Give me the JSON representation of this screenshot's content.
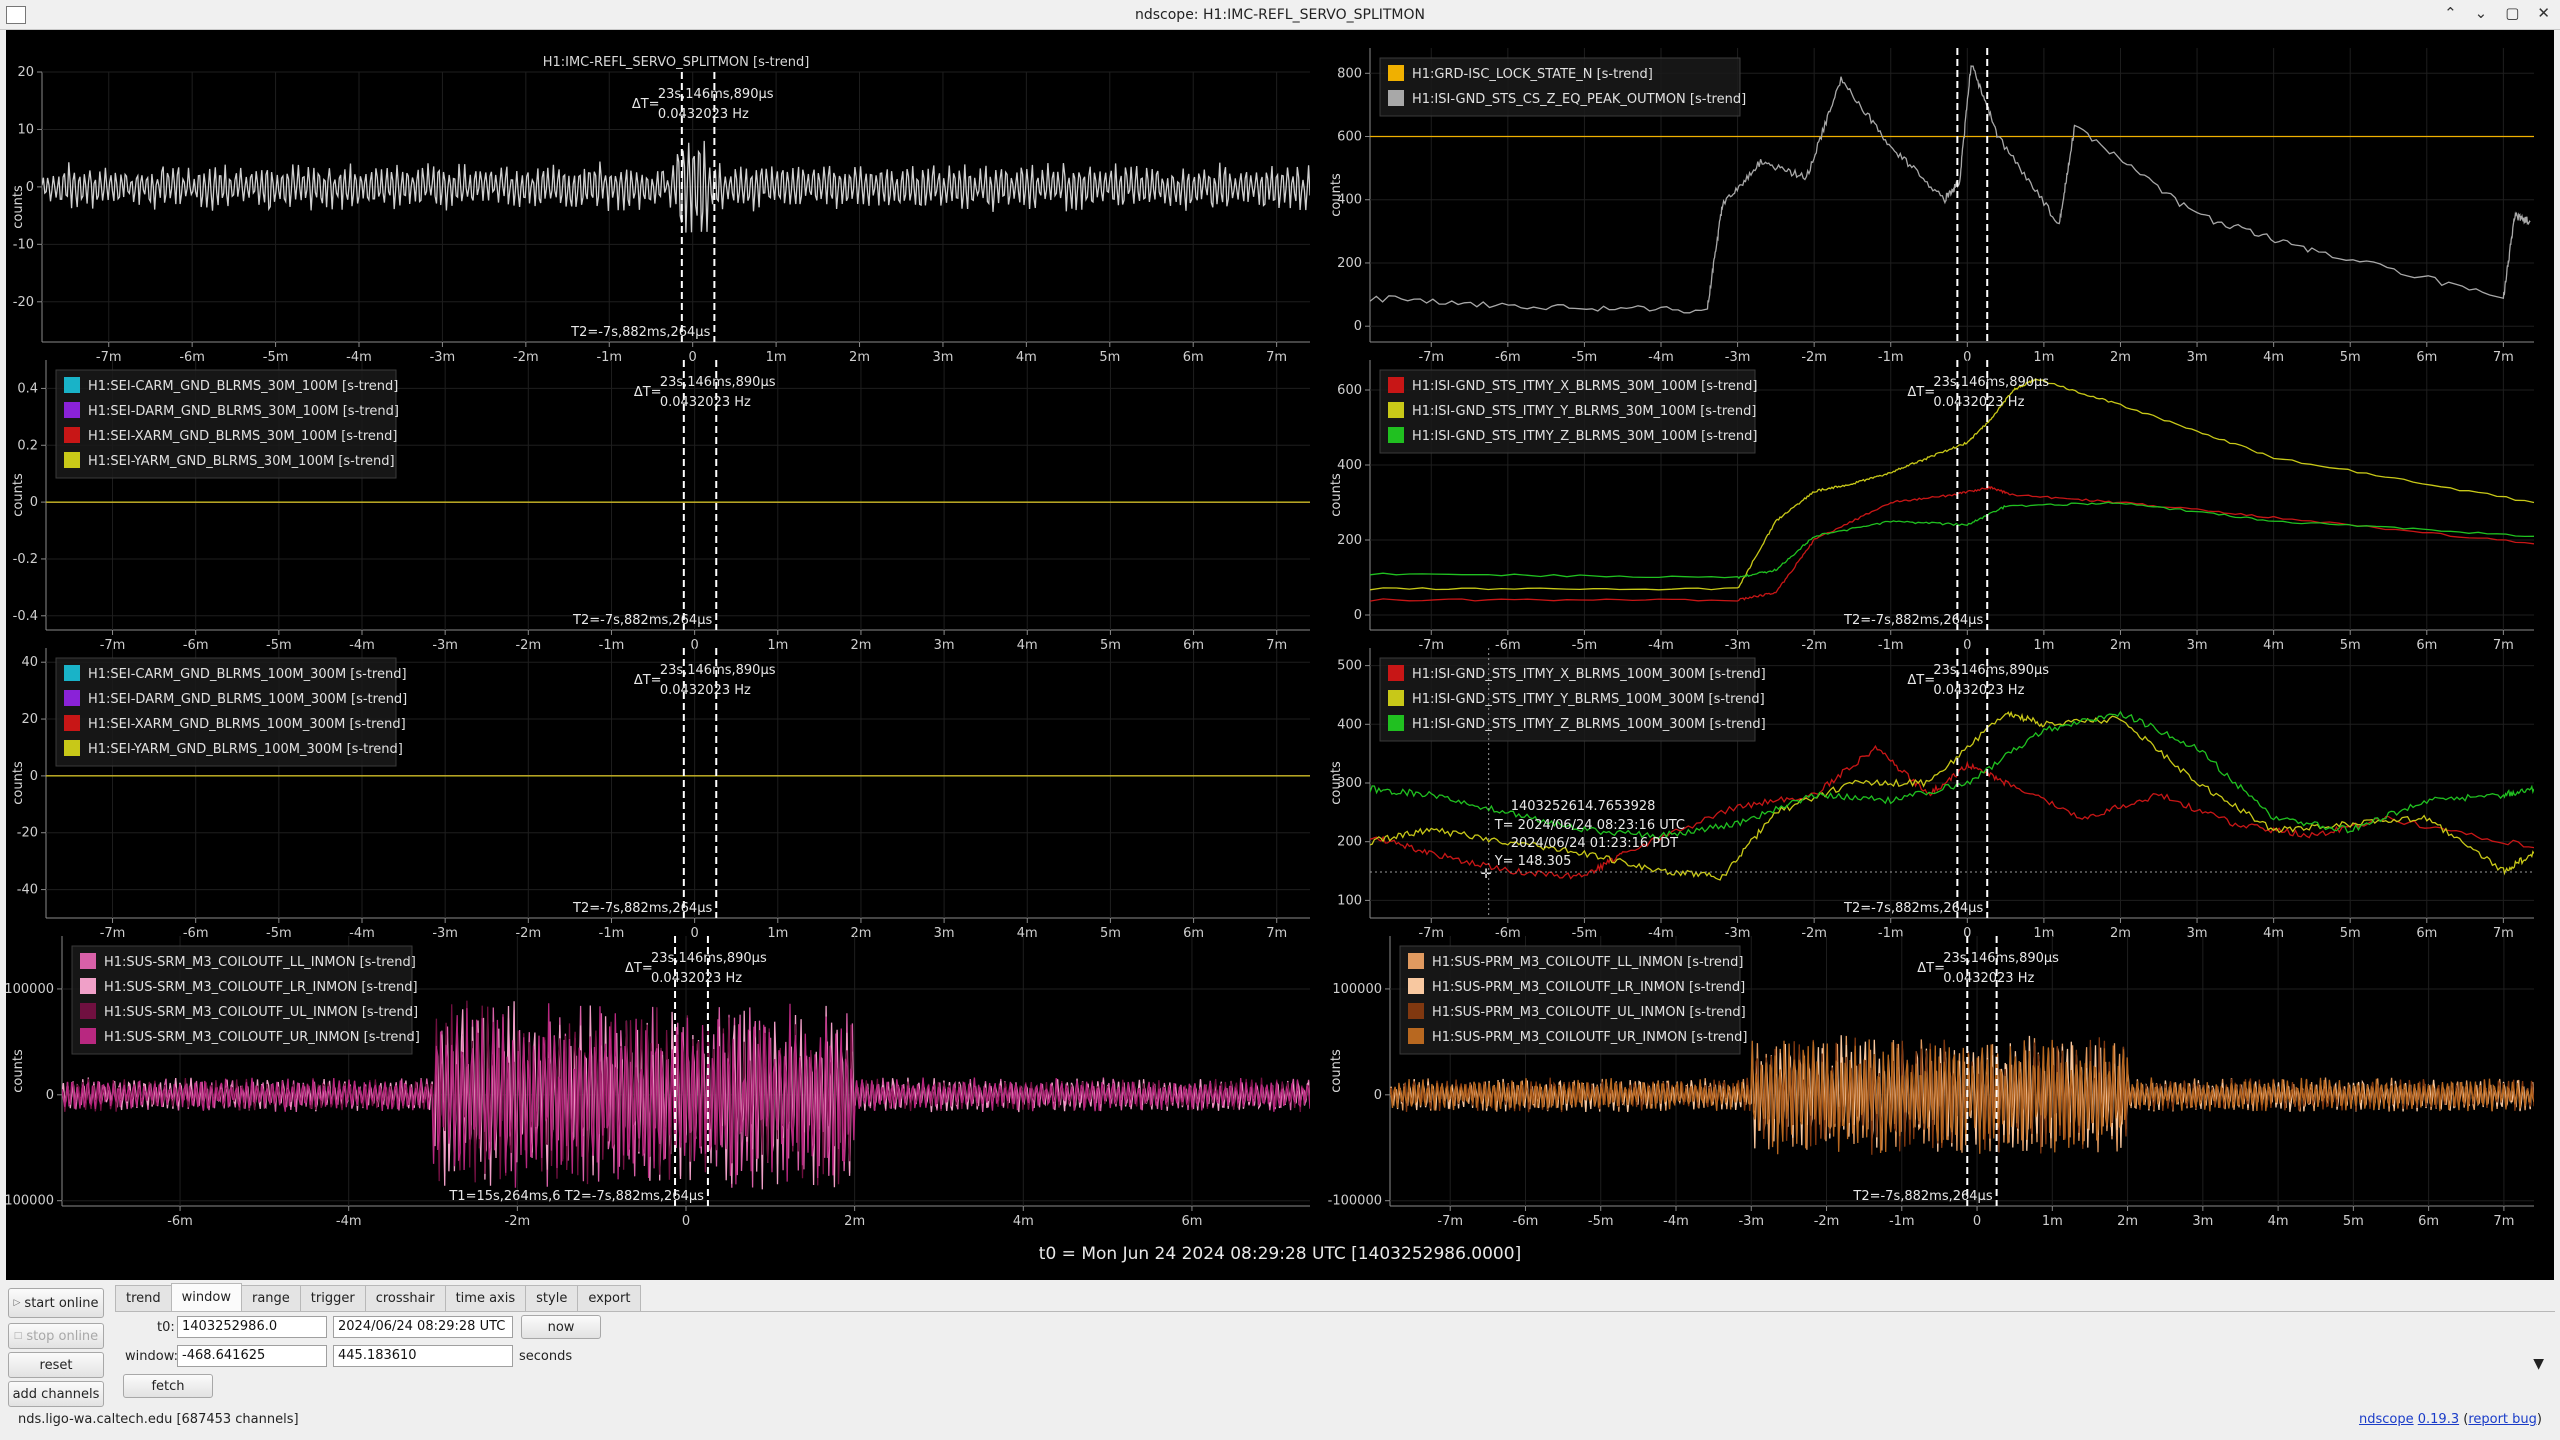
{
  "window": {
    "title": "ndscope: H1:IMC-REFL_SERVO_SPLITMON",
    "controls": [
      "⌃",
      "⌄",
      "▢",
      "✕"
    ]
  },
  "plots": [
    {
      "ylabel": "counts",
      "title": "H1:IMC-REFL_SERVO_SPLITMON [s-trend]",
      "yticks": [
        "20",
        "10",
        "0",
        "-10",
        "-20"
      ],
      "xticks": [
        "-7m",
        "-6m",
        "-5m",
        "-4m",
        "-3m",
        "-2m",
        "-1m",
        "0",
        "1m",
        "2m",
        "3m",
        "4m",
        "5m",
        "6m",
        "7m"
      ],
      "cursor_dt": "23s,146ms,890μs",
      "cursor_freq": "0.0432023 Hz",
      "cursor_dt_prefix": "ΔT=",
      "cursor_t": "T2=-7s,882ms,264μs",
      "legend": []
    },
    {
      "ylabel": "counts",
      "title": "",
      "yticks": [
        "800",
        "600",
        "400",
        "200",
        "0"
      ],
      "xticks": [
        "-7m",
        "-6m",
        "-5m",
        "-4m",
        "-3m",
        "-2m",
        "-1m",
        "0",
        "1m",
        "2m",
        "3m",
        "4m",
        "5m",
        "6m",
        "7m"
      ],
      "cursor_dt": "",
      "cursor_freq": "",
      "cursor_dt_prefix": "",
      "cursor_t": "",
      "legend": [
        {
          "name": "H1:GRD-ISC_LOCK_STATE_N [s-trend]",
          "color": "#f0b000"
        },
        {
          "name": "H1:ISI-GND_STS_CS_Z_EQ_PEAK_OUTMON [s-trend]",
          "color": "#a8a8a8"
        }
      ]
    },
    {
      "ylabel": "counts",
      "title": "",
      "yticks": [
        "0.4",
        "0.2",
        "0",
        "-0.2",
        "-0.4"
      ],
      "xticks": [
        "-7m",
        "-6m",
        "-5m",
        "-4m",
        "-3m",
        "-2m",
        "-1m",
        "0",
        "1m",
        "2m",
        "3m",
        "4m",
        "5m",
        "6m",
        "7m"
      ],
      "cursor_dt": "23s,146ms,890μs",
      "cursor_freq": "0.0432023 Hz",
      "cursor_dt_prefix": "ΔT=",
      "cursor_t": "T2=-7s,882ms,264μs",
      "legend": [
        {
          "name": "H1:SEI-CARM_GND_BLRMS_30M_100M [s-trend]",
          "color": "#19b3c8"
        },
        {
          "name": "H1:SEI-DARM_GND_BLRMS_30M_100M [s-trend]",
          "color": "#8a22d8"
        },
        {
          "name": "H1:SEI-XARM_GND_BLRMS_30M_100M [s-trend]",
          "color": "#c81616"
        },
        {
          "name": "H1:SEI-YARM_GND_BLRMS_30M_100M [s-trend]",
          "color": "#c8c818"
        }
      ]
    },
    {
      "ylabel": "counts",
      "title": "",
      "yticks": [
        "600",
        "400",
        "200",
        "0"
      ],
      "xticks": [
        "-7m",
        "-6m",
        "-5m",
        "-4m",
        "-3m",
        "-2m",
        "-1m",
        "0",
        "1m",
        "2m",
        "3m",
        "4m",
        "5m",
        "6m",
        "7m"
      ],
      "cursor_dt": "23s,146ms,890μs",
      "cursor_freq": "0.0432023 Hz",
      "cursor_dt_prefix": "ΔT=",
      "cursor_t": "T2=-7s,882ms,264μs",
      "legend": [
        {
          "name": "H1:ISI-GND_STS_ITMY_X_BLRMS_30M_100M [s-trend]",
          "color": "#c81616"
        },
        {
          "name": "H1:ISI-GND_STS_ITMY_Y_BLRMS_30M_100M [s-trend]",
          "color": "#c8c818"
        },
        {
          "name": "H1:ISI-GND_STS_ITMY_Z_BLRMS_30M_100M [s-trend]",
          "color": "#20c020"
        }
      ]
    },
    {
      "ylabel": "counts",
      "title": "",
      "yticks": [
        "40",
        "20",
        "0",
        "-20",
        "-40"
      ],
      "xticks": [
        "-7m",
        "-6m",
        "-5m",
        "-4m",
        "-3m",
        "-2m",
        "-1m",
        "0",
        "1m",
        "2m",
        "3m",
        "4m",
        "5m",
        "6m",
        "7m"
      ],
      "cursor_dt": "23s,146ms,890μs",
      "cursor_freq": "0.0432023 Hz",
      "cursor_dt_prefix": "ΔT=",
      "cursor_t": "T2=-7s,882ms,264μs",
      "legend": [
        {
          "name": "H1:SEI-CARM_GND_BLRMS_100M_300M [s-trend]",
          "color": "#19b3c8"
        },
        {
          "name": "H1:SEI-DARM_GND_BLRMS_100M_300M [s-trend]",
          "color": "#8a22d8"
        },
        {
          "name": "H1:SEI-XARM_GND_BLRMS_100M_300M [s-trend]",
          "color": "#c81616"
        },
        {
          "name": "H1:SEI-YARM_GND_BLRMS_100M_300M [s-trend]",
          "color": "#c8c818"
        }
      ]
    },
    {
      "ylabel": "counts",
      "title": "",
      "yticks": [
        "500",
        "400",
        "300",
        "200",
        "100"
      ],
      "xticks": [
        "-7m",
        "-6m",
        "-5m",
        "-4m",
        "-3m",
        "-2m",
        "-1m",
        "0",
        "1m",
        "2m",
        "3m",
        "4m",
        "5m",
        "6m",
        "7m"
      ],
      "cursor_dt": "23s,146ms,890μs",
      "cursor_freq": "0.0432023 Hz",
      "cursor_dt_prefix": "ΔT=",
      "cursor_t": "T2=-7s,882ms,264μs",
      "legend": [
        {
          "name": "H1:ISI-GND_STS_ITMY_X_BLRMS_100M_300M [s-trend]",
          "color": "#c81616"
        },
        {
          "name": "H1:ISI-GND_STS_ITMY_Y_BLRMS_100M_300M [s-trend]",
          "color": "#c8c818"
        },
        {
          "name": "H1:ISI-GND_STS_ITMY_Z_BLRMS_100M_300M [s-trend]",
          "color": "#20c020"
        }
      ],
      "crosshair": {
        "gps": "1403252614.7653928",
        "utc": "T= 2024/06/24 08:23:16 UTC",
        "pdt": "2024/06/24 01:23:16 PDT",
        "y": "Y= 148.305"
      }
    },
    {
      "ylabel": "counts",
      "title": "",
      "yticks": [
        "100000",
        "0",
        "-100000"
      ],
      "xticks": [
        "-6m",
        "-4m",
        "-2m",
        "0",
        "2m",
        "4m",
        "6m"
      ],
      "cursor_dt": "23s,146ms,890μs",
      "cursor_freq": "0.0432023 Hz",
      "cursor_dt_prefix": "ΔT=",
      "cursor_t": "T1=15s,264ms,6 T2=-7s,882ms,264μs",
      "legend": [
        {
          "name": "H1:SUS-SRM_M3_COILOUTF_LL_INMON [s-trend]",
          "color": "#d860a8"
        },
        {
          "name": "H1:SUS-SRM_M3_COILOUTF_LR_INMON [s-trend]",
          "color": "#f0a0c8"
        },
        {
          "name": "H1:SUS-SRM_M3_COILOUTF_UL_INMON [s-trend]",
          "color": "#701040"
        },
        {
          "name": "H1:SUS-SRM_M3_COILOUTF_UR_INMON [s-trend]",
          "color": "#b82880"
        }
      ]
    },
    {
      "ylabel": "counts",
      "title": "",
      "yticks": [
        "100000",
        "0",
        "-100000"
      ],
      "xticks": [
        "-7m",
        "-6m",
        "-5m",
        "-4m",
        "-3m",
        "-2m",
        "-1m",
        "0",
        "1m",
        "2m",
        "3m",
        "4m",
        "5m",
        "6m",
        "7m"
      ],
      "cursor_dt": "23s,146ms,890μs",
      "cursor_freq": "0.0432023 Hz",
      "cursor_dt_prefix": "ΔT=",
      "cursor_t": "T2=-7s,882ms,264μs",
      "legend": [
        {
          "name": "H1:SUS-PRM_M3_COILOUTF_LL_INMON [s-trend]",
          "color": "#e09a60"
        },
        {
          "name": "H1:SUS-PRM_M3_COILOUTF_LR_INMON [s-trend]",
          "color": "#f8c8a0"
        },
        {
          "name": "H1:SUS-PRM_M3_COILOUTF_UL_INMON [s-trend]",
          "color": "#803810"
        },
        {
          "name": "H1:SUS-PRM_M3_COILOUTF_UR_INMON [s-trend]",
          "color": "#b86820"
        }
      ]
    }
  ],
  "t0_label": "t0 = Mon Jun 24 2024 08:29:28 UTC [1403252986.0000]",
  "left_buttons": {
    "start": "start online",
    "stop": "stop online",
    "reset": "reset",
    "add": "add channels"
  },
  "tabs": [
    "trend",
    "window",
    "range",
    "trigger",
    "crosshair",
    "time axis",
    "style",
    "export"
  ],
  "active_tab": "window",
  "window_tab": {
    "t0_label": "t0:",
    "t0_gps": "1403252986.0",
    "t0_utc": "2024/06/24 08:29:28 UTC",
    "now": "now",
    "window_label": "window:",
    "win_start": "-468.641625",
    "win_end": "445.183610",
    "seconds": "seconds",
    "fetch": "fetch"
  },
  "status": "nds.ligo-wa.caltech.edu  [687453 channels]",
  "version": {
    "name": "ndscope",
    "num": "0.19.3",
    "bug": "report bug"
  },
  "chart_data": [
    {
      "type": "line",
      "x_unit": "minutes relative to t0",
      "xlim": [
        -7.8,
        7.4
      ],
      "ylim": [
        -27,
        20
      ],
      "series": [
        {
          "name": "H1:IMC-REFL_SERVO_SPLITMON [s-trend]",
          "description": "noise fluctuating around 0, amplitude ~±3, spike to ~8 near 0"
        }
      ]
    },
    {
      "type": "line",
      "x_unit": "minutes relative to t0",
      "xlim": [
        -7.8,
        7.4
      ],
      "ylim": [
        -50,
        880
      ],
      "series": [
        {
          "name": "H1:GRD-ISC_LOCK_STATE_N [s-trend]",
          "x": [
            -7.8,
            7.4
          ],
          "y": [
            600,
            600
          ]
        },
        {
          "name": "H1:ISI-GND_STS_CS_Z_EQ_PEAK_OUTMON [s-trend]",
          "x": [
            -7.8,
            -5.5,
            -3.4,
            -3.2,
            -2.7,
            -2.1,
            -1.65,
            -1.0,
            -0.3,
            -0.1,
            0.05,
            0.4,
            1.2,
            1.4,
            3.0,
            4.5,
            7.0,
            7.15,
            7.35
          ],
          "y": [
            90,
            60,
            50,
            380,
            520,
            470,
            780,
            570,
            400,
            460,
            830,
            600,
            320,
            630,
            350,
            240,
            90,
            350,
            330
          ]
        }
      ]
    },
    {
      "type": "line",
      "x_unit": "minutes relative to t0",
      "xlim": [
        -7.8,
        7.4
      ],
      "ylim": [
        -0.45,
        0.5
      ],
      "series": [
        {
          "name": "H1:SEI-CARM_GND_BLRMS_30M_100M [s-trend]",
          "x": [
            -7.8,
            7.4
          ],
          "y": [
            0,
            0
          ]
        },
        {
          "name": "H1:SEI-DARM_GND_BLRMS_30M_100M [s-trend]",
          "x": [
            -7.8,
            7.4
          ],
          "y": [
            0,
            0
          ]
        },
        {
          "name": "H1:SEI-XARM_GND_BLRMS_30M_100M [s-trend]",
          "x": [
            -7.8,
            7.4
          ],
          "y": [
            0,
            0
          ]
        },
        {
          "name": "H1:SEI-YARM_GND_BLRMS_30M_100M [s-trend]",
          "x": [
            -7.8,
            7.4
          ],
          "y": [
            0,
            0
          ]
        }
      ]
    },
    {
      "type": "line",
      "x_unit": "minutes relative to t0",
      "xlim": [
        -7.8,
        7.4
      ],
      "ylim": [
        -40,
        680
      ],
      "series": [
        {
          "name": "H1:ISI-GND_STS_ITMY_X_BLRMS_30M_100M [s-trend]",
          "x": [
            -7.8,
            -3.0,
            -2.5,
            -2.0,
            -1.0,
            -0.2,
            0.3,
            0.6,
            2.0,
            4.0,
            7.4
          ],
          "y": [
            40,
            40,
            60,
            200,
            300,
            320,
            340,
            320,
            300,
            260,
            190
          ]
        },
        {
          "name": "H1:ISI-GND_STS_ITMY_Y_BLRMS_30M_100M [s-trend]",
          "x": [
            -7.8,
            -3.0,
            -2.5,
            -2.0,
            -1.5,
            -1.0,
            -0.5,
            0,
            0.3,
            0.6,
            0.9,
            2.0,
            4.0,
            7.4
          ],
          "y": [
            70,
            70,
            250,
            330,
            350,
            380,
            420,
            460,
            520,
            600,
            630,
            560,
            420,
            300
          ]
        },
        {
          "name": "H1:ISI-GND_STS_ITMY_Z_BLRMS_30M_100M [s-trend]",
          "x": [
            -7.8,
            -3.0,
            -2.5,
            -2.0,
            -1.0,
            0,
            0.5,
            2.0,
            4.0,
            7.4
          ],
          "y": [
            110,
            100,
            120,
            210,
            250,
            240,
            290,
            300,
            250,
            210
          ]
        }
      ]
    },
    {
      "type": "line",
      "x_unit": "minutes relative to t0",
      "xlim": [
        -7.8,
        7.4
      ],
      "ylim": [
        -50,
        45
      ],
      "series": [
        {
          "name": "H1:SEI-CARM_GND_BLRMS_100M_300M [s-trend]",
          "x": [
            -7.8,
            7.4
          ],
          "y": [
            0,
            0
          ]
        },
        {
          "name": "H1:SEI-DARM_GND_BLRMS_100M_300M [s-trend]",
          "x": [
            -7.8,
            7.4
          ],
          "y": [
            0,
            0
          ]
        },
        {
          "name": "H1:SEI-XARM_GND_BLRMS_100M_300M [s-trend]",
          "x": [
            -7.8,
            7.4
          ],
          "y": [
            0,
            0
          ]
        },
        {
          "name": "H1:SEI-YARM_GND_BLRMS_100M_300M [s-trend]",
          "x": [
            -7.8,
            7.4
          ],
          "y": [
            0,
            0
          ]
        }
      ]
    },
    {
      "type": "line",
      "x_unit": "minutes relative to t0",
      "xlim": [
        -7.8,
        7.4
      ],
      "ylim": [
        70,
        530
      ],
      "series": [
        {
          "name": "H1:ISI-GND_STS_ITMY_X_BLRMS_100M_300M [s-trend]",
          "x": [
            -7.8,
            -7,
            -6,
            -5,
            -4.5,
            -3,
            -2,
            -1.2,
            -0.5,
            0,
            0.5,
            1.5,
            2.5,
            3.5,
            4.5,
            5.5,
            7.4
          ],
          "y": [
            210,
            180,
            150,
            140,
            180,
            260,
            280,
            360,
            280,
            330,
            300,
            240,
            280,
            230,
            210,
            240,
            190
          ]
        },
        {
          "name": "H1:ISI-GND_STS_ITMY_Y_BLRMS_100M_300M [s-trend]",
          "x": [
            -7.8,
            -7,
            -6,
            -5,
            -4,
            -3.2,
            -2.5,
            -1.5,
            -0.5,
            0.5,
            1.0,
            2.0,
            3.0,
            4.0,
            5.0,
            6.0,
            7.0,
            7.4
          ],
          "y": [
            200,
            220,
            200,
            180,
            150,
            140,
            250,
            300,
            300,
            420,
            400,
            410,
            300,
            220,
            230,
            240,
            150,
            180
          ]
        },
        {
          "name": "H1:ISI-GND_STS_ITMY_Z_BLRMS_100M_300M [s-trend]",
          "x": [
            -7.8,
            -7,
            -6,
            -5,
            -4,
            -3,
            -2,
            -1,
            0,
            1.0,
            2.0,
            3.0,
            4.0,
            5.0,
            6.0,
            7.0,
            7.4
          ],
          "y": [
            290,
            280,
            250,
            220,
            210,
            230,
            280,
            270,
            300,
            390,
            420,
            360,
            240,
            220,
            270,
            280,
            290
          ]
        }
      ]
    },
    {
      "type": "line",
      "x_unit": "minutes relative to t0",
      "xlim": [
        -7.4,
        7.4
      ],
      "ylim": [
        -105000,
        150000
      ],
      "series": [
        {
          "name": "H1:SUS-SRM_M3_COILOUTF_LL_INMON [s-trend]",
          "description": "oscillation around 0, amplitude ~10000 outside -3m..2m, up to ~70000 within"
        },
        {
          "name": "H1:SUS-SRM_M3_COILOUTF_LR_INMON [s-trend]",
          "description": "similar"
        },
        {
          "name": "H1:SUS-SRM_M3_COILOUTF_UL_INMON [s-trend]",
          "description": "similar"
        },
        {
          "name": "H1:SUS-SRM_M3_COILOUTF_UR_INMON [s-trend]",
          "description": "similar"
        }
      ]
    },
    {
      "type": "line",
      "x_unit": "minutes relative to t0",
      "xlim": [
        -7.8,
        7.4
      ],
      "ylim": [
        -105000,
        150000
      ],
      "series": [
        {
          "name": "H1:SUS-PRM_M3_COILOUTF_LL_INMON [s-trend]",
          "description": "oscillation around 0, amplitude ~10000 outside -3m..2m, up to ~50000 within"
        },
        {
          "name": "H1:SUS-PRM_M3_COILOUTF_LR_INMON [s-trend]",
          "description": "similar"
        },
        {
          "name": "H1:SUS-PRM_M3_COILOUTF_UL_INMON [s-trend]",
          "description": "similar"
        },
        {
          "name": "H1:SUS-PRM_M3_COILOUTF_UR_INMON [s-trend]",
          "description": "similar"
        }
      ]
    }
  ]
}
